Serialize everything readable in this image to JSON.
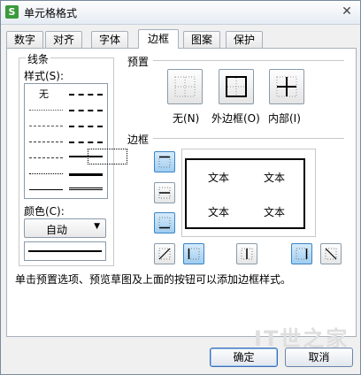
{
  "window": {
    "title": "单元格格式",
    "close_glyph": "✕"
  },
  "tabs": [
    "数字",
    "对齐",
    "字体",
    "边框",
    "图案",
    "保护"
  ],
  "active_tab": 3,
  "line_section": {
    "title": "线条",
    "style_label": "样式(S):",
    "none_label": "无",
    "color_label": "颜色(C):",
    "color_value": "自动"
  },
  "presets": {
    "title": "预置",
    "items": [
      {
        "label": "无(N)",
        "icon": "preset-none-icon"
      },
      {
        "label": "外边框(O)",
        "icon": "preset-outline-icon"
      },
      {
        "label": "内部(I)",
        "icon": "preset-inside-icon"
      }
    ]
  },
  "border_section": {
    "title": "边框",
    "preview_texts": [
      "文本",
      "文本",
      "文本",
      "文本"
    ]
  },
  "hint": "单击预置选项、预览草图及上面的按钮可以添加边框样式。",
  "buttons": {
    "ok": "确定",
    "cancel": "取消"
  },
  "watermark": "IT世之家",
  "colors": {
    "accent": "#3a84c4",
    "toggle_on": "#9fcdf1"
  }
}
